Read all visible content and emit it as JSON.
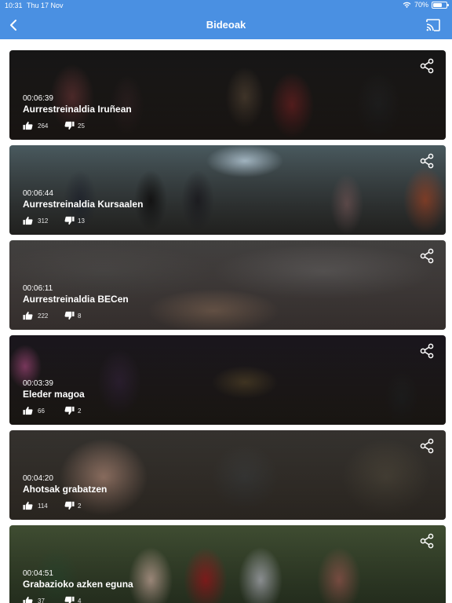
{
  "status_bar": {
    "time": "10:31",
    "date": "Thu 17 Nov",
    "battery": "70%",
    "battery_level": 0.7,
    "wifi_icon": "wifi-icon"
  },
  "navbar": {
    "title": "Bideoak",
    "back_icon": "chevron-left-icon",
    "cast_icon": "cast-icon",
    "background": "#4a90e2"
  },
  "videos": [
    {
      "duration": "00:06:39",
      "title": "Aurrestreinaldia Iruñean",
      "likes": "264",
      "dislikes": "25"
    },
    {
      "duration": "00:06:44",
      "title": "Aurrestreinaldia Kursaalen",
      "likes": "312",
      "dislikes": "13"
    },
    {
      "duration": "00:06:11",
      "title": "Aurrestreinaldia BECen",
      "likes": "222",
      "dislikes": "8"
    },
    {
      "duration": "00:03:39",
      "title": "Eleder magoa",
      "likes": "66",
      "dislikes": "2"
    },
    {
      "duration": "00:04:20",
      "title": "Ahotsak grabatzen",
      "likes": "114",
      "dislikes": "2"
    },
    {
      "duration": "00:04:51",
      "title": "Grabazioko azken eguna",
      "likes": "37",
      "dislikes": "4"
    }
  ]
}
